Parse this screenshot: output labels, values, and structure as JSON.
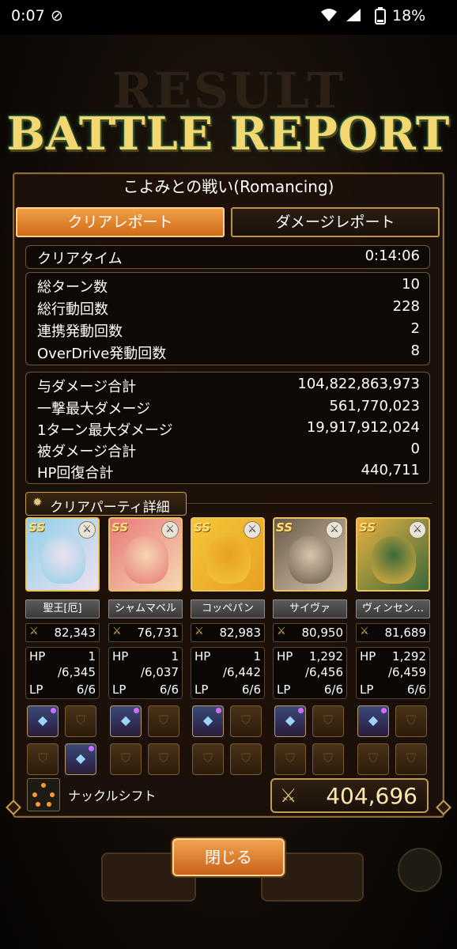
{
  "status_bar": {
    "time": "0:07",
    "battery": "18%"
  },
  "title": "BATTLE REPORT",
  "background_title": "RESULT",
  "battle_name": "こよみとの戦い(Romancing)",
  "tabs": [
    {
      "label": "クリアレポート",
      "active": true
    },
    {
      "label": "ダメージレポート",
      "active": false
    }
  ],
  "clear_time": {
    "label": "クリアタイム",
    "value": "0:14:06"
  },
  "turn_stats": [
    {
      "label": "総ターン数",
      "value": "10"
    },
    {
      "label": "総行動回数",
      "value": "228"
    },
    {
      "label": "連携発動回数",
      "value": "2"
    },
    {
      "label": "OverDrive発動回数",
      "value": "8"
    }
  ],
  "damage_stats": [
    {
      "label": "与ダメージ合計",
      "value": "104,822,863,973"
    },
    {
      "label": "一撃最大ダメージ",
      "value": "561,770,023"
    },
    {
      "label": "1ターン最大ダメージ",
      "value": "19,917,912,024"
    },
    {
      "label": "被ダメージ合計",
      "value": "0"
    },
    {
      "label": "HP回復合計",
      "value": "440,711"
    }
  ],
  "party_header": "クリアパーティ詳細",
  "party": [
    {
      "name": "聖王[厄]",
      "power": "82,343",
      "hp": "1",
      "hp_max": "/6,345",
      "lp": "6/6",
      "portrait_colors": [
        "#8fd0e8",
        "#f0e0f0"
      ],
      "gear_filled": [
        true,
        false,
        false,
        true
      ]
    },
    {
      "name": "シャムマベル",
      "power": "76,731",
      "hp": "1",
      "hp_max": "/6,037",
      "lp": "6/6",
      "portrait_colors": [
        "#e87a7a",
        "#f5d7b0"
      ],
      "gear_filled": [
        true,
        false,
        false,
        false
      ]
    },
    {
      "name": "コッペパン",
      "power": "82,983",
      "hp": "1",
      "hp_max": "/6,442",
      "lp": "6/6",
      "portrait_colors": [
        "#f4c63a",
        "#e8a020"
      ],
      "gear_filled": [
        true,
        false,
        false,
        false
      ]
    },
    {
      "name": "サイヴァ",
      "power": "80,950",
      "hp": "1,292",
      "hp_max": "/6,456",
      "lp": "6/6",
      "portrait_colors": [
        "#6a5a4a",
        "#d8c8b0"
      ],
      "gear_filled": [
        true,
        false,
        false,
        false
      ]
    },
    {
      "name": "ヴィンセン…",
      "power": "81,689",
      "hp": "1,292",
      "hp_max": "/6,459",
      "lp": "6/6",
      "portrait_colors": [
        "#e8b040",
        "#3a6a3a"
      ],
      "gear_filled": [
        true,
        false,
        false,
        false
      ]
    }
  ],
  "stat_labels": {
    "hp": "HP",
    "lp": "LP"
  },
  "formation": "ナックルシフト",
  "total_power": "404,696",
  "close_button": "閉じる",
  "colors": {
    "accent": "#d06a16",
    "gold": "#e8c35e",
    "panel": "#1c1109"
  },
  "icons": [
    "wifi-icon",
    "signal-icon",
    "battery-icon",
    "sword-icon",
    "gear-icon",
    "element-icon",
    "formation-icon"
  ]
}
